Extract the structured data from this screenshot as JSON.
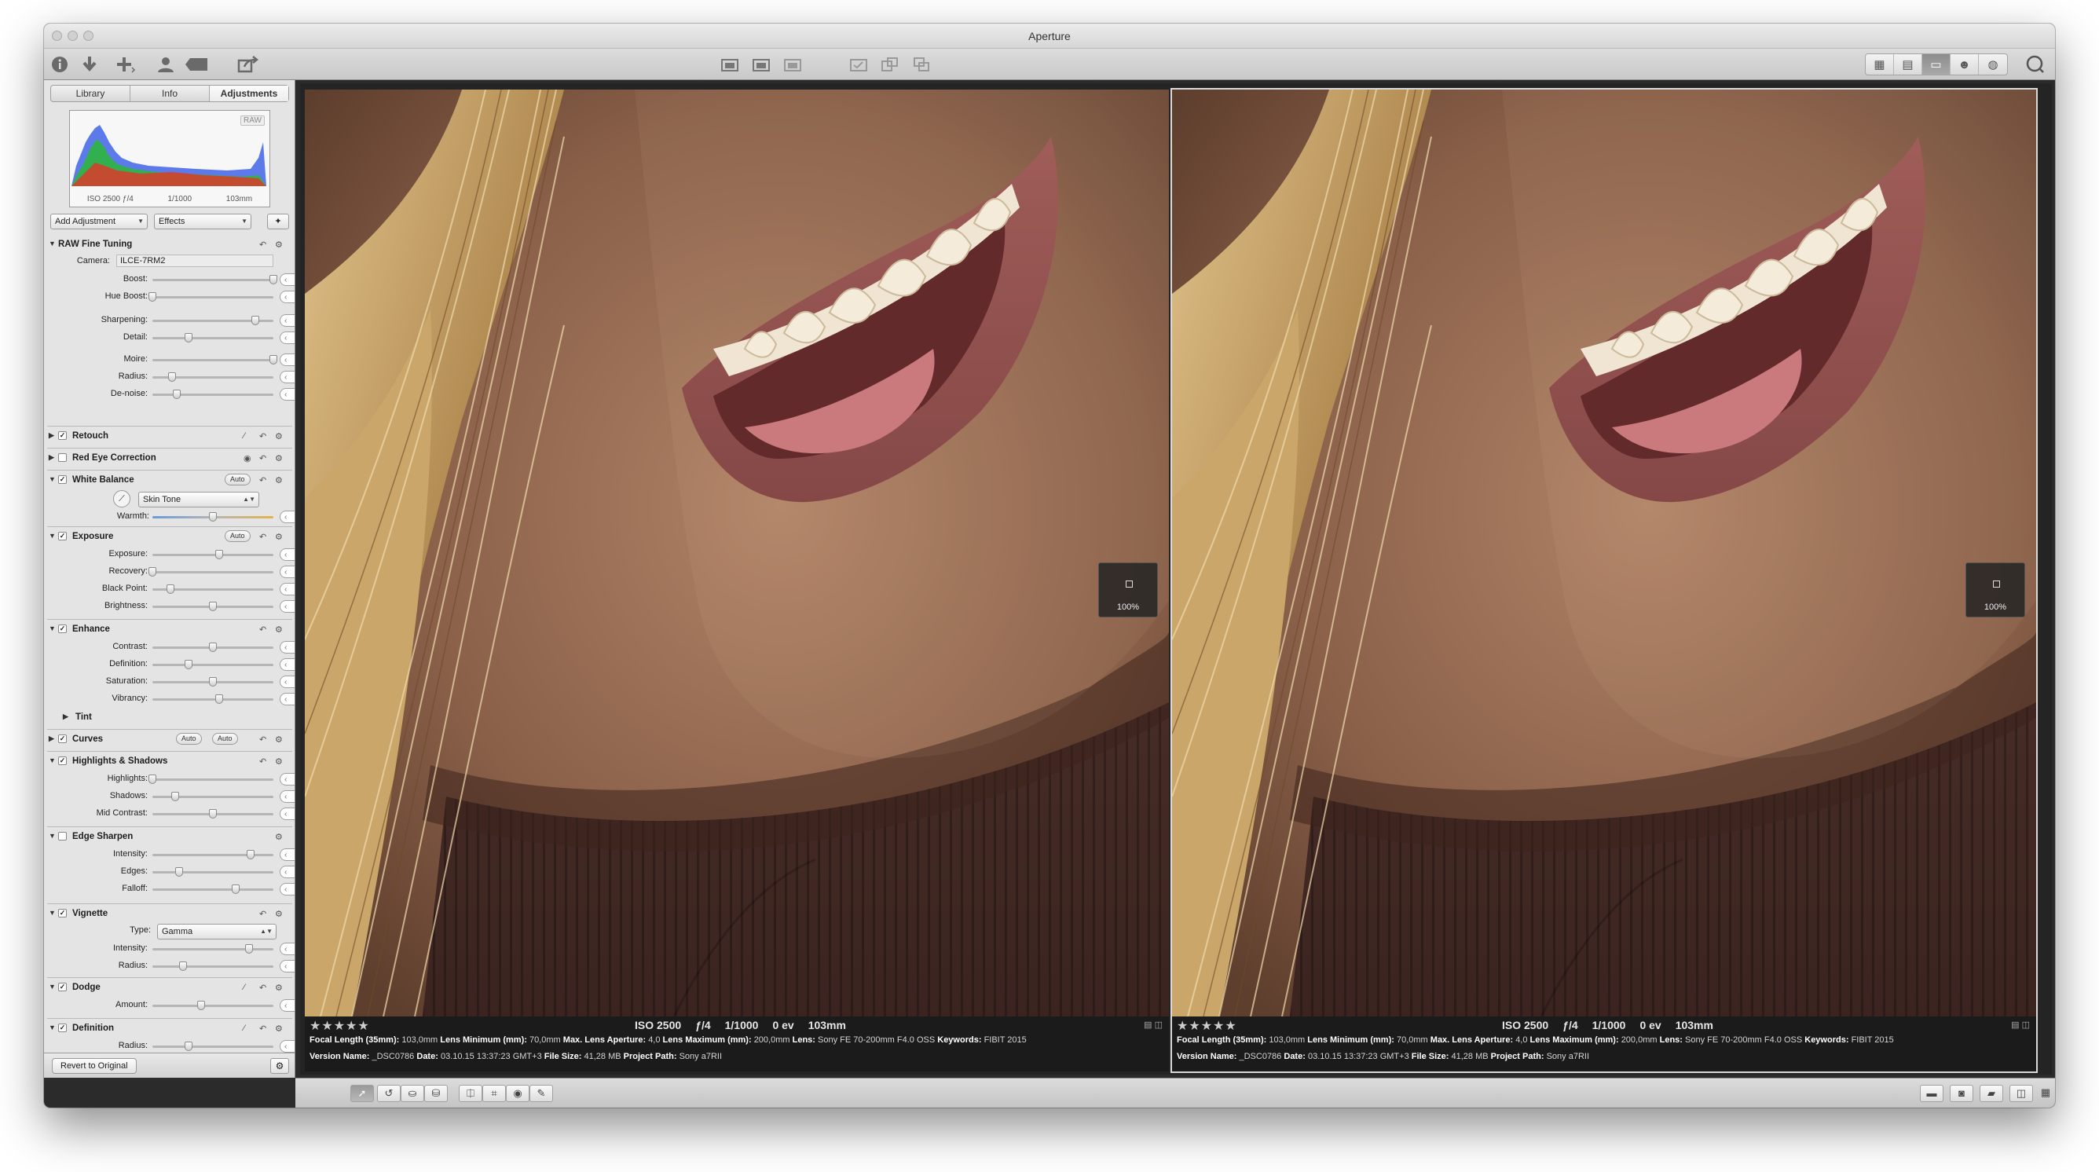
{
  "window": {
    "title": "Aperture"
  },
  "toolbar": {
    "left_icons": [
      "info-icon",
      "import-icon",
      "new-icon",
      "faces-icon",
      "tag-icon",
      "share-icon"
    ],
    "center_icons": [
      "stack-icon",
      "stack-icon",
      "stack-icon",
      "rotate-icon",
      "rotate-icon",
      "rotate-icon"
    ],
    "view_modes": [
      "grid-view-icon",
      "list-view-icon",
      "viewer-icon",
      "faces-view-icon",
      "places-view-icon"
    ],
    "search_icon": "search-icon"
  },
  "inspector": {
    "tabs": [
      "Library",
      "Info",
      "Adjustments"
    ],
    "active_tab": "Adjustments",
    "histogram": {
      "badge": "RAW",
      "iso": "ISO 2500",
      "aperture": "ƒ/4",
      "shutter": "1/1000",
      "focal": "103mm"
    },
    "add_adjustment": "Add Adjustment",
    "effects": "Effects",
    "raw_fine_tuning": {
      "title": "RAW Fine Tuning",
      "camera_label": "Camera:",
      "camera": "ILCE-7RM2"
    },
    "sliders_raw": [
      {
        "label": "Boost:",
        "value": "1,00",
        "pos": 1.0
      },
      {
        "label": "Hue Boost:",
        "value": "0,00",
        "pos": 0.0
      },
      {
        "label": "Sharpening:",
        "value": "0,85",
        "pos": 0.85
      },
      {
        "label": "Detail:",
        "value": "0,30",
        "pos": 0.3
      },
      {
        "label": "Moire:",
        "value": "1,00",
        "pos": 1.0
      },
      {
        "label": "Radius:",
        "value": "4,00",
        "pos": 0.16
      },
      {
        "label": "De-noise:",
        "value": "0,20",
        "pos": 0.2
      }
    ],
    "retouch": "Retouch",
    "red_eye": "Red Eye Correction",
    "white_balance": {
      "title": "White Balance",
      "auto": "Auto",
      "mode": "Skin Tone",
      "warmth_label": "Warmth:",
      "warmth": "0,50",
      "warmth_pos": 0.5
    },
    "exposure": {
      "title": "Exposure",
      "auto": "Auto",
      "sliders": [
        {
          "label": "Exposure:",
          "value": "0,2",
          "pos": 0.55
        },
        {
          "label": "Recovery:",
          "value": "0,0",
          "pos": 0.0
        },
        {
          "label": "Black Point:",
          "value": "3,0",
          "pos": 0.15
        },
        {
          "label": "Brightness:",
          "value": "0,0",
          "pos": 0.5
        }
      ]
    },
    "enhance": {
      "title": "Enhance",
      "tint": "Tint",
      "sliders": [
        {
          "label": "Contrast:",
          "value": "0,0",
          "pos": 0.5
        },
        {
          "label": "Definition:",
          "value": "0,3",
          "pos": 0.3
        },
        {
          "label": "Saturation:",
          "value": "1,0",
          "pos": 0.5
        },
        {
          "label": "Vibrancy:",
          "value": "0,1",
          "pos": 0.55
        }
      ]
    },
    "curves": {
      "title": "Curves",
      "auto1": "Auto",
      "auto2": "Auto"
    },
    "highlights_shadows": {
      "title": "Highlights & Shadows",
      "sliders": [
        {
          "label": "Highlights:",
          "value": "0,0",
          "pos": 0.0
        },
        {
          "label": "Shadows:",
          "value": "19,0",
          "pos": 0.19
        },
        {
          "label": "Mid Contrast:",
          "value": "0,0",
          "pos": 0.5
        }
      ]
    },
    "edge_sharpen": {
      "title": "Edge Sharpen",
      "sliders": [
        {
          "label": "Intensity:",
          "value": "0,81",
          "pos": 0.81
        },
        {
          "label": "Edges:",
          "value": "0,22",
          "pos": 0.22
        },
        {
          "label": "Falloff:",
          "value": "0,69",
          "pos": 0.69
        }
      ]
    },
    "vignette": {
      "title": "Vignette",
      "type_label": "Type:",
      "type": "Gamma",
      "sliders": [
        {
          "label": "Intensity:",
          "value": "0,6",
          "pos": 0.8
        },
        {
          "label": "Radius:",
          "value": "0,5",
          "pos": 0.25
        }
      ]
    },
    "dodge": {
      "title": "Dodge",
      "sliders": [
        {
          "label": "Amount:",
          "value": "0,4",
          "pos": 0.4
        }
      ]
    },
    "definition": {
      "title": "Definition",
      "sliders": [
        {
          "label": "Radius:",
          "value": "30,0",
          "pos": 0.3
        }
      ]
    },
    "revert": "Revert to Original"
  },
  "viewer": {
    "panes": [
      {
        "zoom": "100%",
        "stars": "★★★★★",
        "iso": "ISO 2500",
        "aperture": "ƒ/4",
        "shutter": "1/1000",
        "ev": "0 ev",
        "focal": "103mm",
        "meta1": [
          [
            "Focal Length (35mm):",
            "103,0mm"
          ],
          [
            "Lens Minimum (mm):",
            "70,0mm"
          ],
          [
            "Max. Lens Aperture:",
            "4,0"
          ],
          [
            "Lens Maximum (mm):",
            "200,0mm"
          ],
          [
            "Lens:",
            "Sony FE 70-200mm F4.0 OSS"
          ],
          [
            "Keywords:",
            "FIBIT 2015"
          ]
        ],
        "meta2": [
          [
            "Version Name:",
            "_DSC0786"
          ],
          [
            "Date:",
            "03.10.15 13:37:23 GMT+3"
          ],
          [
            "File Size:",
            "41,28 MB"
          ],
          [
            "Project Path:",
            "Sony a7RII"
          ]
        ]
      },
      {
        "zoom": "100%",
        "stars": "★★★★★",
        "iso": "ISO 2500",
        "aperture": "ƒ/4",
        "shutter": "1/1000",
        "ev": "0 ev",
        "focal": "103mm",
        "meta1": [
          [
            "Focal Length (35mm):",
            "103,0mm"
          ],
          [
            "Lens Minimum (mm):",
            "70,0mm"
          ],
          [
            "Max. Lens Aperture:",
            "4,0"
          ],
          [
            "Lens Maximum (mm):",
            "200,0mm"
          ],
          [
            "Lens:",
            "Sony FE 70-200mm F4.0 OSS"
          ],
          [
            "Keywords:",
            "FIBIT 2015"
          ]
        ],
        "meta2": [
          [
            "Version Name:",
            "_DSC0786"
          ],
          [
            "Date:",
            "03.10.15 13:37:23 GMT+3"
          ],
          [
            "File Size:",
            "41,28 MB"
          ],
          [
            "Project Path:",
            "Sony a7RII"
          ]
        ]
      }
    ]
  },
  "bottombar": {
    "tools": [
      "select-tool-icon",
      "rotate-tool-icon",
      "stamp-tool-icon",
      "stamp-tool-icon",
      "straighten-tool-icon",
      "crop-tool-icon",
      "redeye-tool-icon",
      "brush-tool-icon"
    ]
  }
}
